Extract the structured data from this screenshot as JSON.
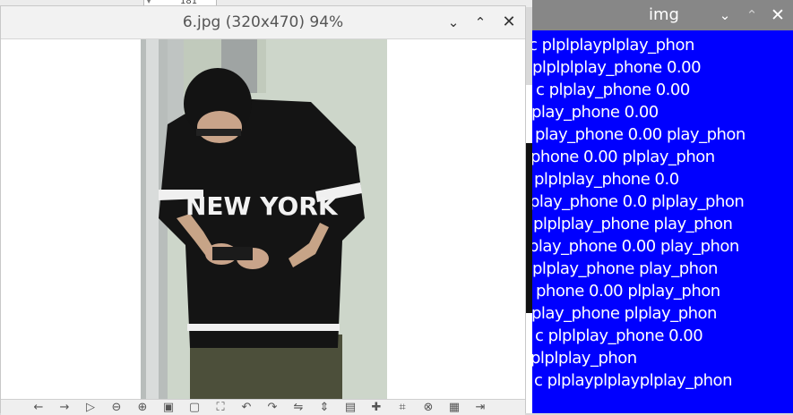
{
  "background": {
    "combo_value": "181"
  },
  "viewer": {
    "title": "6.jpg (320x470) 94%",
    "controls": {
      "minimize": "⌄",
      "maximize": "⌃",
      "close": "✕"
    },
    "photo": {
      "shirt_text": "NEW YORK"
    },
    "toolbar": [
      {
        "name": "back-icon",
        "glyph": "←"
      },
      {
        "name": "forward-icon",
        "glyph": "→"
      },
      {
        "name": "play-icon",
        "glyph": "▷"
      },
      {
        "name": "zoom-out-icon",
        "glyph": "⊖"
      },
      {
        "name": "zoom-in-icon",
        "glyph": "⊕"
      },
      {
        "name": "fit-icon",
        "glyph": "▣"
      },
      {
        "name": "original-size-icon",
        "glyph": "▢"
      },
      {
        "name": "fullscreen-icon",
        "glyph": "⛶"
      },
      {
        "name": "rotate-left-icon",
        "glyph": "↶"
      },
      {
        "name": "rotate-right-icon",
        "glyph": "↷"
      },
      {
        "name": "flip-horizontal-icon",
        "glyph": "⇋"
      },
      {
        "name": "flip-vertical-icon",
        "glyph": "⇕"
      },
      {
        "name": "open-folder-icon",
        "glyph": "▤"
      },
      {
        "name": "add-icon",
        "glyph": "✚"
      },
      {
        "name": "crop-icon",
        "glyph": "⌗"
      },
      {
        "name": "delete-icon",
        "glyph": "⊗"
      },
      {
        "name": "preferences-icon",
        "glyph": "▦"
      },
      {
        "name": "exit-icon",
        "glyph": "⇥"
      }
    ]
  },
  "img_window": {
    "title": "img",
    "controls": {
      "minimize": "⌄",
      "maximize": "⌃",
      "close": "✕"
    },
    "overlay_lines": [
      "c plplplayplplay_phon",
      "plplplplay_phone 0.00",
      "c plplay_phone 0.00",
      "play_phone 0.00",
      "play_phone 0.00 play_phon",
      "phone 0.00 plplay_phon",
      "plplplay_phone 0.0",
      "play_phone 0.0 plplay_phon",
      "plplplay_phone play_phon",
      "play_phone 0.00 play_phon",
      "plplay_phone play_phon",
      "phone 0.00 plplay_phon",
      "play_phone plplay_phon",
      "c plplplay_phone 0.00",
      "plplplay_phon",
      "c plplayplplayplplay_phon"
    ]
  },
  "colors": {
    "overlay_bg": "#0000ff",
    "img_titlebar": "#878787",
    "viewer_titlebar": "#f2f2f2",
    "shirt": "#141414"
  }
}
